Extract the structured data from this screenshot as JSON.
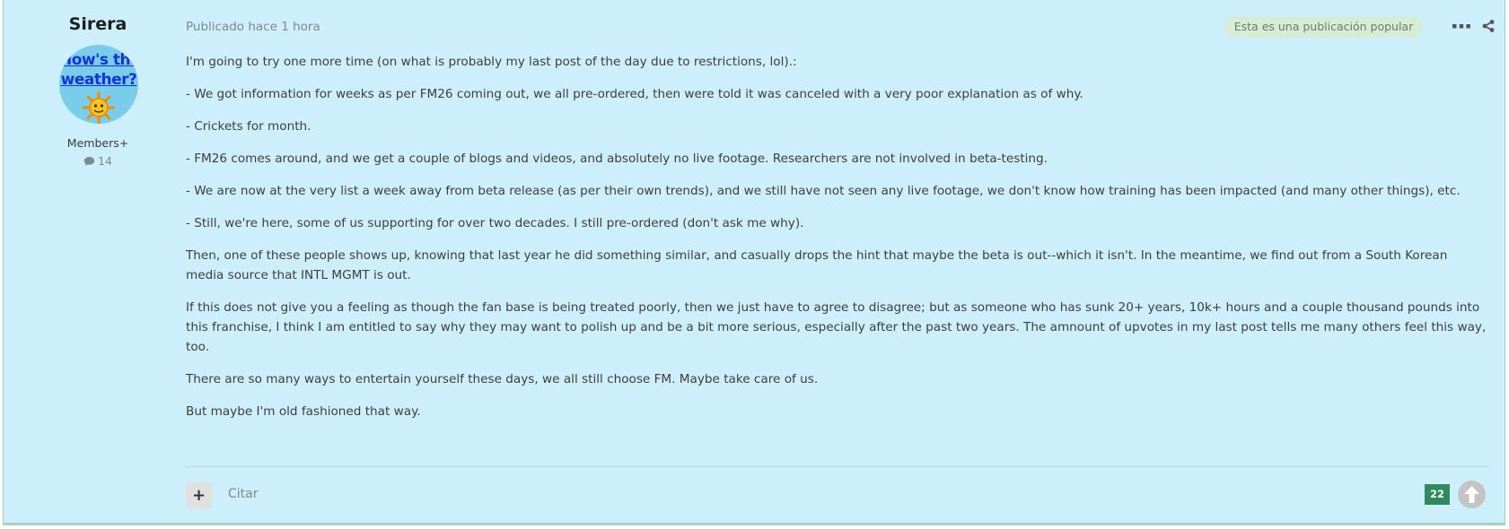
{
  "author": {
    "name": "Sirera",
    "avatar_text": [
      "How's the",
      "weather?"
    ],
    "role": "Members+",
    "post_count": "14"
  },
  "post": {
    "published": "Publicado hace 1 hora",
    "popular_badge": "Esta es una publicación popular",
    "paragraphs": [
      "I'm going to try one more time (on what is probably my last post of the day due to restrictions, lol).:",
      "- We got information for weeks as per FM26 coming out, we all pre-ordered, then were told it was canceled with a very poor explanation as of why.",
      "- Crickets for month.",
      "- FM26 comes around, and we get a couple of blogs and videos, and absolutely no live footage. Researchers are not involved in beta-testing.",
      "- We are now at the very list a week away from beta release (as per their own trends), and we still have not seen any live footage, we don't know how training has been impacted (and many other things), etc.",
      "- Still, we're here, some of us supporting for over two decades. I still pre-ordered (don't ask me why).",
      "Then, one of these people shows up, knowing that last year he did something similar, and casually drops the hint that maybe the beta is out--which it isn't. In the meantime, we find out from a South Korean media source that INTL MGMT is out.",
      "If this does not give you a feeling as though the fan base is being treated poorly, then we just have to agree to disagree; but as someone who has sunk 20+ years, 10k+ hours and a couple thousand pounds into this franchise, I think I am entitled to say why they may want to polish up and be a bit more serious, especially after the past two years. The amnount of upvotes in my last post tells me many others feel this way, too.",
      "There are so many ways to entertain yourself these days, we all still choose FM. Maybe take care of us.",
      "But maybe I'm old fashioned that way."
    ]
  },
  "footer": {
    "plus_label": "+",
    "quote_label": "Citar",
    "reputation": "22"
  },
  "icons": {
    "more": "more-horizontal-icon",
    "share": "share-icon",
    "comment": "comment-icon",
    "upvote": "arrow-up-icon"
  },
  "colors": {
    "post_background": "#cdeefb",
    "badge_background": "#d7ecd4",
    "reputation_background": "#2f8b5e",
    "avatar_link": "#1333d6"
  }
}
